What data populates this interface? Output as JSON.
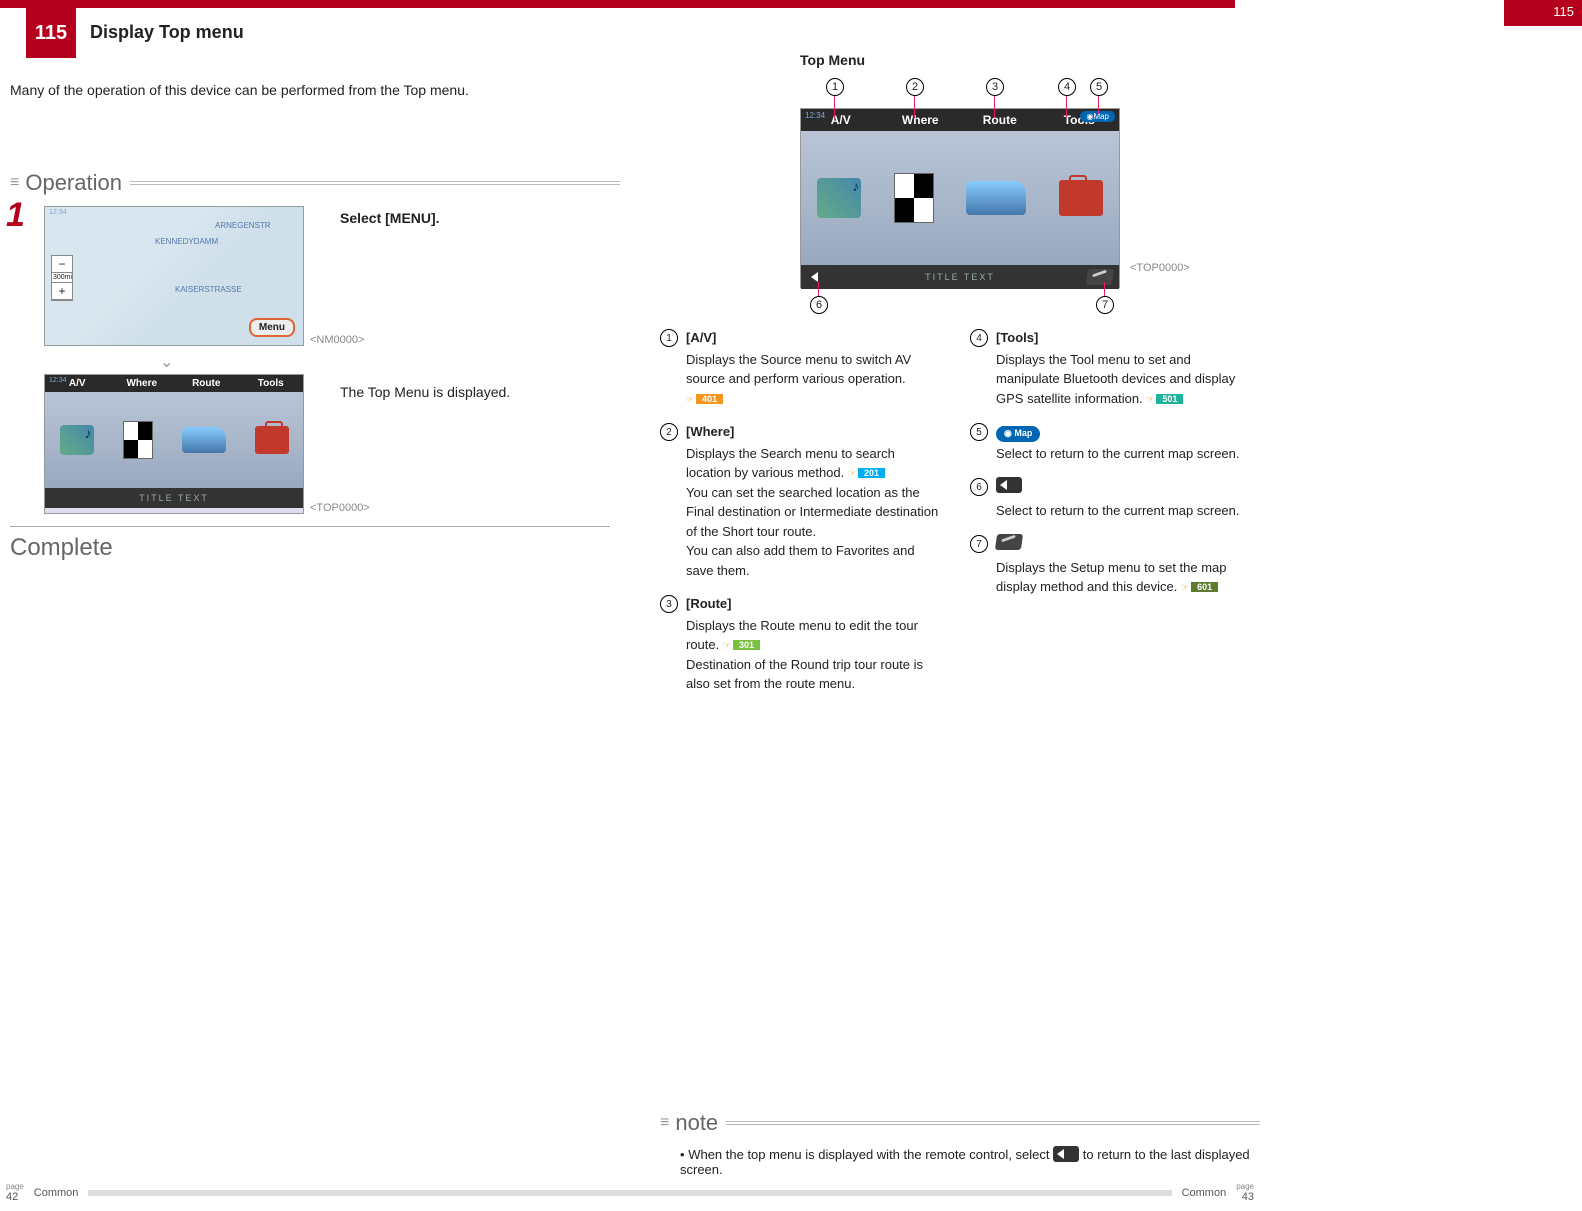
{
  "page_number_badge": "115",
  "corner_page": "115",
  "title": "Display Top menu",
  "intro": "Many of the operation of this device can be performed from the Top menu.",
  "operation_heading": "Operation",
  "step1_num": "1",
  "step1_text": "Select [MENU].",
  "map_labels": {
    "kennedy": "KENNEDYDAMM",
    "arne": "ARNEGENSTR",
    "kaiser": "KAISERSTRASSE",
    "scale": "300mi",
    "plus": "+",
    "minus": "−",
    "menu": "Menu"
  },
  "nm_tag": "<NM0000>",
  "result_text": "The Top Menu is displayed.",
  "top_tag": "<TOP0000>",
  "complete": "Complete",
  "topmenu_title": "Top Menu",
  "tabs": {
    "av": "A/V",
    "where": "Where",
    "route": "Route",
    "tools": "Tools"
  },
  "titletext": "TITLE TEXT",
  "map_btn": "Map",
  "clock": "12:34",
  "callouts": {
    "c1": "1",
    "c2": "2",
    "c3": "3",
    "c4": "4",
    "c5": "5",
    "c6": "6",
    "c7": "7"
  },
  "defs": {
    "d1_head": "[A/V]",
    "d1_body": "Displays the Source menu to switch AV source and perform various operation.",
    "d1_ref": "401",
    "d2_head": "[Where]",
    "d2_body1": "Displays the Search menu to search location by various method.",
    "d2_ref": "201",
    "d2_body2": "You can set the searched location as the Final destination or Intermediate destination of the Short tour route.",
    "d2_body3": "You can also add them to Favorites and save them.",
    "d3_head": "[Route]",
    "d3_body1": "Displays the Route menu to edit the tour route.",
    "d3_ref": "301",
    "d3_body2": "Destination of the Round trip tour route is also set from the route menu.",
    "d4_head": "[Tools]",
    "d4_body": "Displays the Tool menu to set and manipulate Bluetooth devices and display GPS satellite information.",
    "d4_ref": "501",
    "d5_body": "Select to return to the current map screen.",
    "d6_body": "Select to return to the current map screen.",
    "d7_body": "Displays the Setup menu to set the map display method and this device.",
    "d7_ref": "601"
  },
  "note_heading": "note",
  "note_bullet": "•",
  "note_text1": "When the top menu is displayed with the remote control, select",
  "note_text2": "to return to the last displayed screen.",
  "footer": {
    "page_left_label": "page",
    "page_left_num": "42",
    "common": "Common",
    "page_right_label": "page",
    "page_right_num": "43"
  }
}
